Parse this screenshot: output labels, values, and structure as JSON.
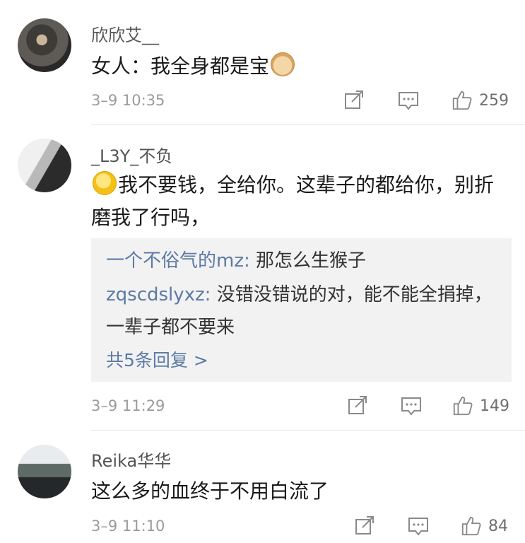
{
  "comments": [
    {
      "username": "欣欣艾__",
      "text": "女人：我全身都是宝",
      "emoji": "doge-emoji",
      "time": "3–9 10:35",
      "likes": "259"
    },
    {
      "username": "_L3Y_不负",
      "emoji": "smile-emoji",
      "text": "我不要钱，全给你。这辈子的都给你，别折磨我了行吗，",
      "time": "3–9 11:29",
      "likes": "149",
      "replies": [
        {
          "name": "一个不俗气的mz:",
          "text": " 那怎么生猴子"
        },
        {
          "name": "zqscdslyxz:",
          "text": " 没错没错说的对，能不能全捐掉，一辈子都不要来"
        }
      ],
      "more_replies": "共5条回复 >"
    },
    {
      "username": "Reika华华",
      "text": "这么多的血终于不用白流了",
      "time": "3–9 11:10",
      "likes": "84"
    }
  ],
  "colors": {
    "link": "#5b7aa6",
    "reply_bg": "#f2f2f2",
    "meta": "#9a9a9a"
  }
}
